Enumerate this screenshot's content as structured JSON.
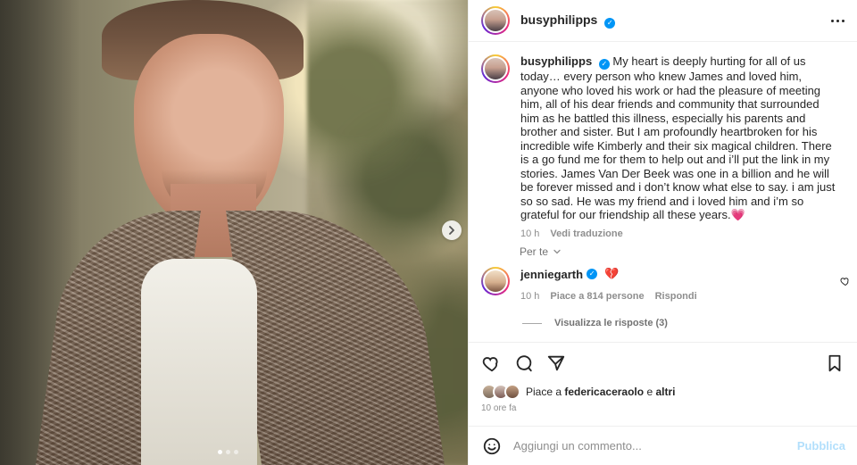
{
  "post": {
    "username": "busyphilipps",
    "caption": "My heart is deeply hurting for all of us today… every person who knew James and loved him, anyone who loved his work or had the pleasure of meeting him, all of his dear friends and community that surrounded him as he battled this illness, especially his parents and brother and sister. But I am profoundly heartbroken for his incredible wife Kimberly and their six magical children. There is a go fund me for them to help out and i’ll put the link in my stories. James Van Der Beek was one in a billion and he will be forever missed and i don’t know what else to say. i am just so so sad. He was my friend and i loved him and i’m so grateful for our friendship all these years.💗",
    "caption_time": "10 h",
    "translate_label": "Vedi traduzione",
    "audience_label": "Per te"
  },
  "comment": {
    "username": "jenniegarth",
    "emoji": "💔",
    "time": "10 h",
    "likes_label": "Piace a 814 persone",
    "reply_label": "Rispondi",
    "view_replies": "Visualizza le risposte (3)"
  },
  "likes": {
    "prefix": "Piace a",
    "user": "federicaceraolo",
    "suffix": "e",
    "others": "altri",
    "time_ago": "10 ore fa"
  },
  "composer": {
    "placeholder": "Aggiungi un commento...",
    "publish": "Pubblica"
  },
  "media": {
    "carousel_total": 3,
    "active_index": 1
  },
  "colors": {
    "accent": "#0095f6",
    "muted": "#8e8e8e",
    "publish_disabled": "#b2dffc"
  },
  "icons": [
    "verified-icon",
    "more-icon",
    "heart-icon",
    "comment-icon",
    "share-icon",
    "save-icon",
    "emoji-icon",
    "chevron-right-icon",
    "chevron-down-icon"
  ]
}
